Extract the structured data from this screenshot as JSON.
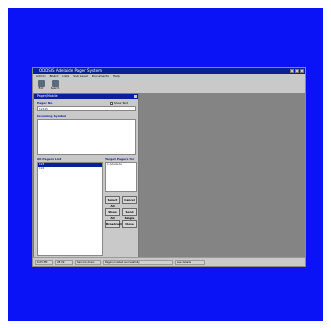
{
  "window": {
    "title": "ODDSIS Adelaide Pager System"
  },
  "menu": [
    "Admin",
    "Board",
    "Lists",
    "Sub Level",
    "Documents",
    "Help"
  ],
  "toolbar": [
    {
      "label": "Exit",
      "icon": "door-icon"
    },
    {
      "label": "Search",
      "icon": "search-icon"
    }
  ],
  "dialog": {
    "title": "Pager/Mobile",
    "pager_no_label": "Pager No",
    "pager_no_value": "12345",
    "show_text_label": "Show Text",
    "incoming_symbol_label": "Incoming Symbol",
    "all_pagers_label": "All Pagers List",
    "all_pagers": [
      "123",
      "124"
    ],
    "target_pagers_label": "Target Pagers for sending",
    "target_pagers": [
      "1 Adelaide"
    ],
    "buttons": {
      "select_all": "Select All",
      "cancel": "Cancel",
      "show_all": "Show All",
      "send_single": "Send Single",
      "broadcast": "Broadcast",
      "close": "Close"
    }
  },
  "status": [
    "6.05 PM",
    "28 09",
    "Service down",
    "Pagers loaded successfully",
    "see details"
  ]
}
